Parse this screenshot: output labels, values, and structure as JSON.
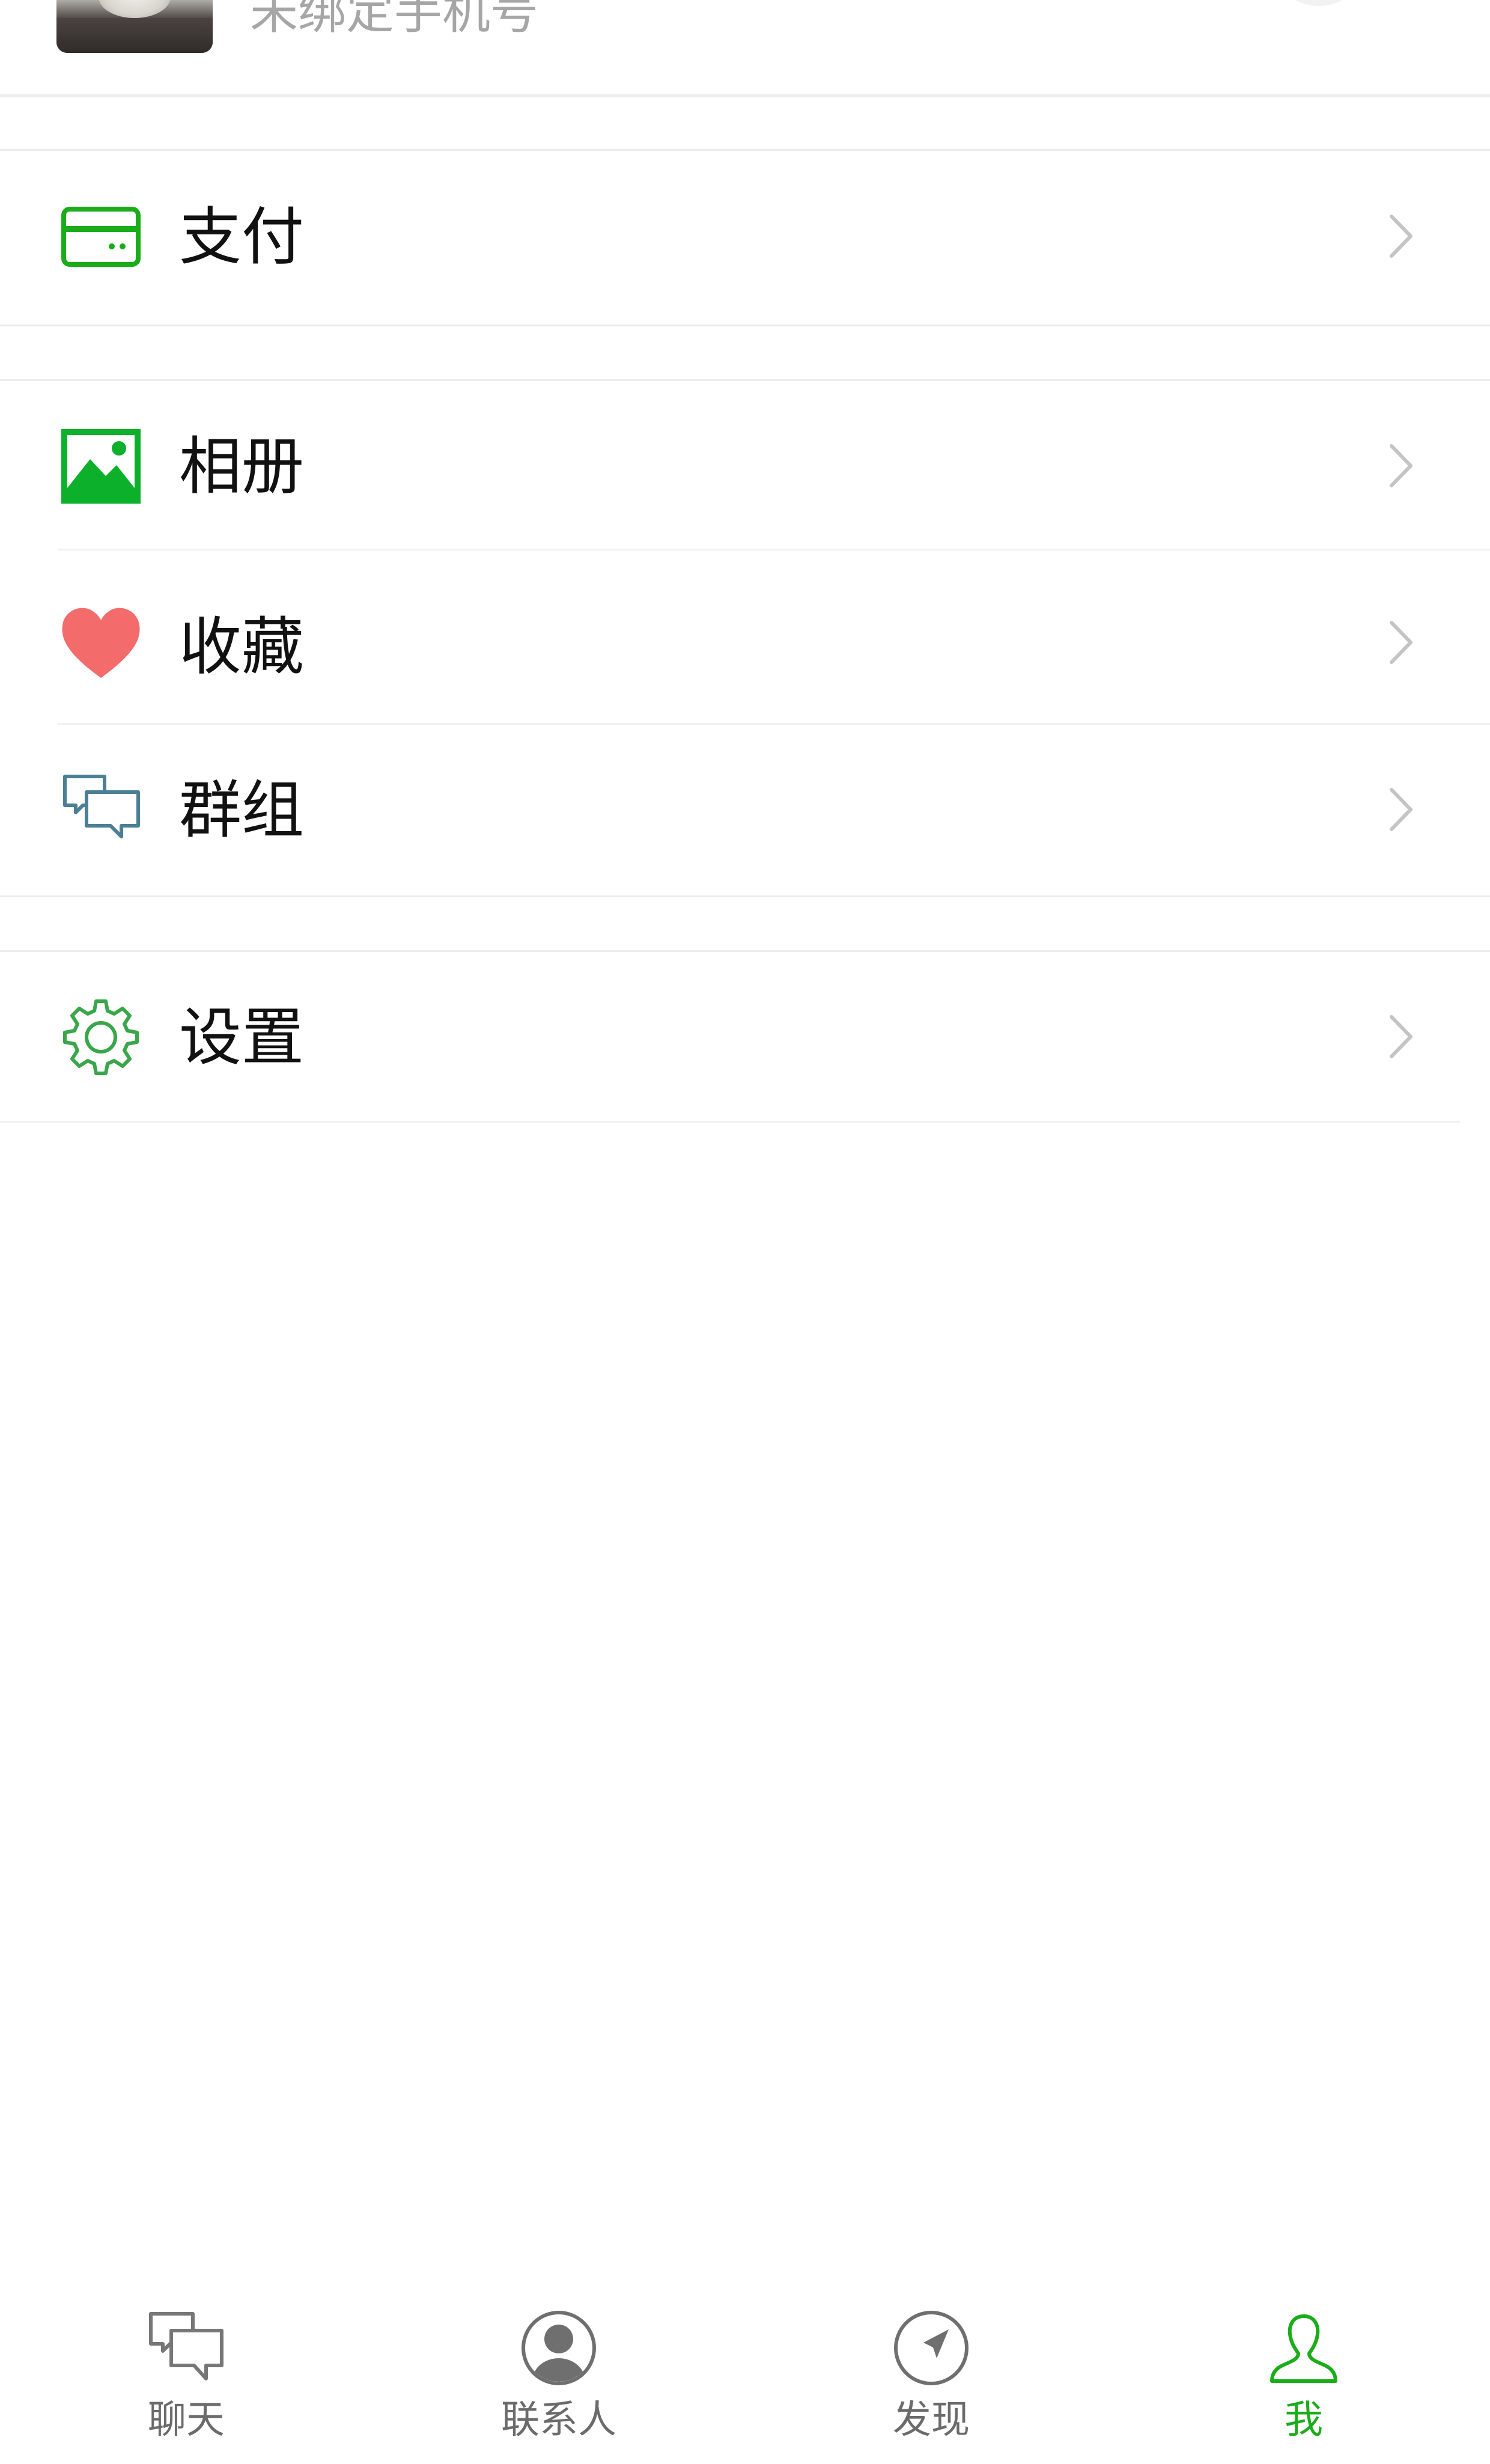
{
  "profile": {
    "phone_status": "未绑定手机号"
  },
  "menu": {
    "pay": {
      "label": "支付",
      "icon": "wallet-card-icon"
    },
    "album": {
      "label": "相册",
      "icon": "photo-album-icon"
    },
    "favorites": {
      "label": "收藏",
      "icon": "heart-icon"
    },
    "groups": {
      "label": "群组",
      "icon": "chat-bubbles-icon"
    },
    "settings": {
      "label": "设置",
      "icon": "gear-icon"
    }
  },
  "tabbar": {
    "tabs": [
      {
        "label": "聊天",
        "icon": "chat-bubbles-icon",
        "active": false
      },
      {
        "label": "联系人",
        "icon": "contact-person-icon",
        "active": false
      },
      {
        "label": "发现",
        "icon": "compass-icon",
        "active": false
      },
      {
        "label": "我",
        "icon": "me-person-icon",
        "active": true
      }
    ]
  },
  "colors": {
    "accent": "#1aad19",
    "heart": "#f36b6b",
    "label": "#111111",
    "muted": "#a6a6a6",
    "tab_inactive": "#6b6b6b"
  }
}
